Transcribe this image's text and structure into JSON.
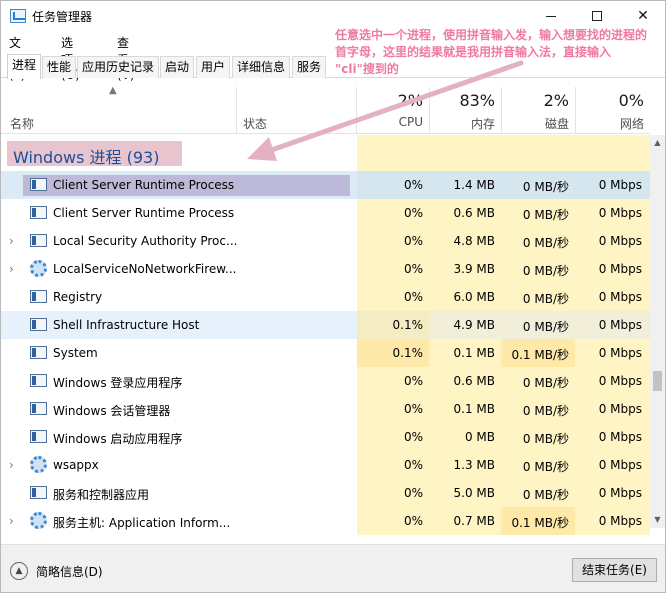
{
  "window": {
    "title": "任务管理器"
  },
  "menu": [
    "文件(F)",
    "选项(O)",
    "查看(V)"
  ],
  "tabs": [
    "进程",
    "性能",
    "应用历史记录",
    "启动",
    "用户",
    "详细信息",
    "服务"
  ],
  "header": {
    "name": "名称",
    "status": "状态",
    "cpu": {
      "pct": "2%",
      "label": "CPU"
    },
    "memory": {
      "pct": "83%",
      "label": "内存"
    },
    "disk": {
      "pct": "2%",
      "label": "磁盘"
    },
    "network": {
      "pct": "0%",
      "label": "网络"
    }
  },
  "group": {
    "label": "Windows 进程 (93)"
  },
  "rows": [
    {
      "name": "Client Server Runtime Process",
      "cpu": "0%",
      "mem": "1.4 MB",
      "disk": "0 MB/秒",
      "net": "0 Mbps",
      "icon": "window-icon",
      "expand": false
    },
    {
      "name": "Client Server Runtime Process",
      "cpu": "0%",
      "mem": "0.6 MB",
      "disk": "0 MB/秒",
      "net": "0 Mbps",
      "icon": "window-icon",
      "expand": false
    },
    {
      "name": "Local Security Authority Proc...",
      "cpu": "0%",
      "mem": "4.8 MB",
      "disk": "0 MB/秒",
      "net": "0 Mbps",
      "icon": "window-icon",
      "expand": true
    },
    {
      "name": "LocalServiceNoNetworkFirew...",
      "cpu": "0%",
      "mem": "3.9 MB",
      "disk": "0 MB/秒",
      "net": "0 Mbps",
      "icon": "gear-icon",
      "expand": true
    },
    {
      "name": "Registry",
      "cpu": "0%",
      "mem": "6.0 MB",
      "disk": "0 MB/秒",
      "net": "0 Mbps",
      "icon": "window-icon",
      "expand": false
    },
    {
      "name": "Shell Infrastructure Host",
      "cpu": "0.1%",
      "mem": "4.9 MB",
      "disk": "0 MB/秒",
      "net": "0 Mbps",
      "icon": "window-icon",
      "expand": false
    },
    {
      "name": "System",
      "cpu": "0.1%",
      "mem": "0.1 MB",
      "disk": "0.1 MB/秒",
      "net": "0 Mbps",
      "icon": "window-icon",
      "expand": false
    },
    {
      "name": "Windows 登录应用程序",
      "cpu": "0%",
      "mem": "0.6 MB",
      "disk": "0 MB/秒",
      "net": "0 Mbps",
      "icon": "window-icon",
      "expand": false
    },
    {
      "name": "Windows 会话管理器",
      "cpu": "0%",
      "mem": "0.1 MB",
      "disk": "0 MB/秒",
      "net": "0 Mbps",
      "icon": "window-icon",
      "expand": false
    },
    {
      "name": "Windows 启动应用程序",
      "cpu": "0%",
      "mem": "0 MB",
      "disk": "0 MB/秒",
      "net": "0 Mbps",
      "icon": "window-icon",
      "expand": false
    },
    {
      "name": "wsappx",
      "cpu": "0%",
      "mem": "1.3 MB",
      "disk": "0 MB/秒",
      "net": "0 Mbps",
      "icon": "gear-icon",
      "expand": true
    },
    {
      "name": "服务和控制器应用",
      "cpu": "0%",
      "mem": "5.0 MB",
      "disk": "0 MB/秒",
      "net": "0 Mbps",
      "icon": "window-icon",
      "expand": false
    },
    {
      "name": "服务主机: Application Inform...",
      "cpu": "0%",
      "mem": "0.7 MB",
      "disk": "0.1 MB/秒",
      "net": "0 Mbps",
      "icon": "gear-icon",
      "expand": true
    }
  ],
  "footer": {
    "fewer_details": "简略信息(D)",
    "end_task": "结束任务(E)"
  },
  "annotation": {
    "text": "任意选中一个进程，使用拼音输入发，输入想要找的进程的首字母，这里的结果就是我用拼音输入法，直接输入 \"cli\"搜到的"
  },
  "colors": {
    "cpu_bg": "#fff4c4",
    "mem_bg": "#fff4c4",
    "disk_bg": "#fff4c4",
    "net_bg": "#fff4c4",
    "accent": "#1c4f9a",
    "annotation": "#f07aa3"
  }
}
